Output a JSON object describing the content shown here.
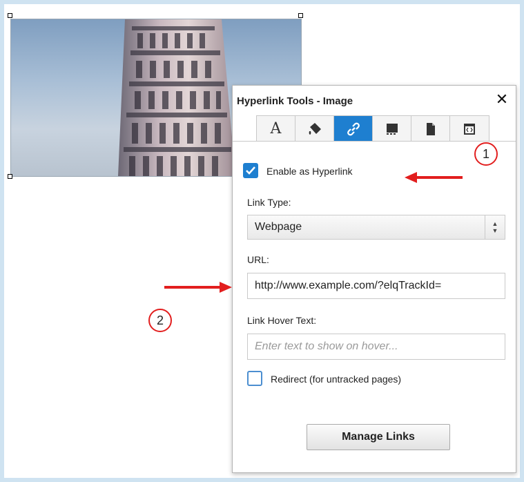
{
  "panel": {
    "title": "Hyperlink Tools - Image",
    "close_icon": "close-icon",
    "tabs": [
      {
        "name": "text-style-icon",
        "label": "A",
        "active": false
      },
      {
        "name": "paint-bucket-icon",
        "active": false
      },
      {
        "name": "hyperlink-icon",
        "active": true
      },
      {
        "name": "image-settings-icon",
        "active": false
      },
      {
        "name": "document-icon",
        "active": false
      },
      {
        "name": "html-code-icon",
        "active": false
      }
    ],
    "enable_hyperlink": {
      "label": "Enable as Hyperlink",
      "checked": true
    },
    "link_type": {
      "label": "Link Type:",
      "value": "Webpage"
    },
    "url": {
      "label": "URL:",
      "value": "http://www.example.com/?elqTrackId="
    },
    "hover_text": {
      "label": "Link Hover Text:",
      "placeholder": "Enter text to show on hover..."
    },
    "redirect": {
      "label": "Redirect (for untracked pages)",
      "checked": false
    },
    "manage_links": "Manage Links"
  },
  "callouts": [
    {
      "number": "1",
      "target": "enable-hyperlink"
    },
    {
      "number": "2",
      "target": "url-field"
    }
  ],
  "colors": {
    "accent": "#1e7fd0",
    "callout_red": "#e21e1e"
  }
}
